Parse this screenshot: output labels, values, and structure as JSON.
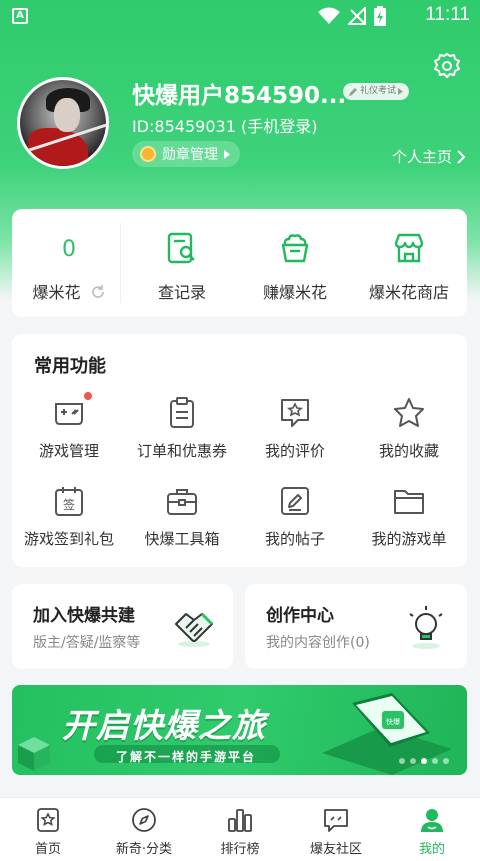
{
  "status_bar": {
    "time": "11:11",
    "app_badge": "A"
  },
  "profile": {
    "username": "快爆用户854590...",
    "exam_badge": "礼仪考试",
    "user_id": "ID:85459031 (手机登录)",
    "medal_button": "勋章管理",
    "homepage_link": "个人主页"
  },
  "stats": {
    "popcorn_count": "0",
    "popcorn_label": "爆米花",
    "records_label": "查记录",
    "earn_label": "赚爆米花",
    "shop_label": "爆米花商店"
  },
  "common_functions": {
    "title": "常用功能",
    "items": [
      {
        "label": "游戏管理",
        "icon": "gamepad-icon"
      },
      {
        "label": "订单和优惠券",
        "icon": "clipboard-icon"
      },
      {
        "label": "我的评价",
        "icon": "star-chat-icon"
      },
      {
        "label": "我的收藏",
        "icon": "star-icon"
      },
      {
        "label": "游戏签到礼包",
        "icon": "calendar-sign-icon"
      },
      {
        "label": "快爆工具箱",
        "icon": "toolbox-icon"
      },
      {
        "label": "我的帖子",
        "icon": "edit-post-icon"
      },
      {
        "label": "我的游戏单",
        "icon": "folder-icon"
      }
    ]
  },
  "join_card": {
    "title": "加入快爆共建",
    "subtitle": "版主/答疑/监察等"
  },
  "create_card": {
    "title": "创作中心",
    "subtitle": "我的内容创作(0)"
  },
  "banner": {
    "title": "开启快爆之旅",
    "subtitle": "了解不一样的手游平台"
  },
  "bottom_nav": [
    {
      "label": "首页",
      "icon": "home-star-icon"
    },
    {
      "label": "新奇·分类",
      "icon": "compass-icon"
    },
    {
      "label": "排行榜",
      "icon": "ranking-icon"
    },
    {
      "label": "爆友社区",
      "icon": "community-icon"
    },
    {
      "label": "我的",
      "icon": "profile-icon",
      "active": true
    }
  ],
  "colors": {
    "brand_green": "#2fcb6c",
    "accent_green": "#22b85f",
    "notify_red": "#f2564e"
  }
}
